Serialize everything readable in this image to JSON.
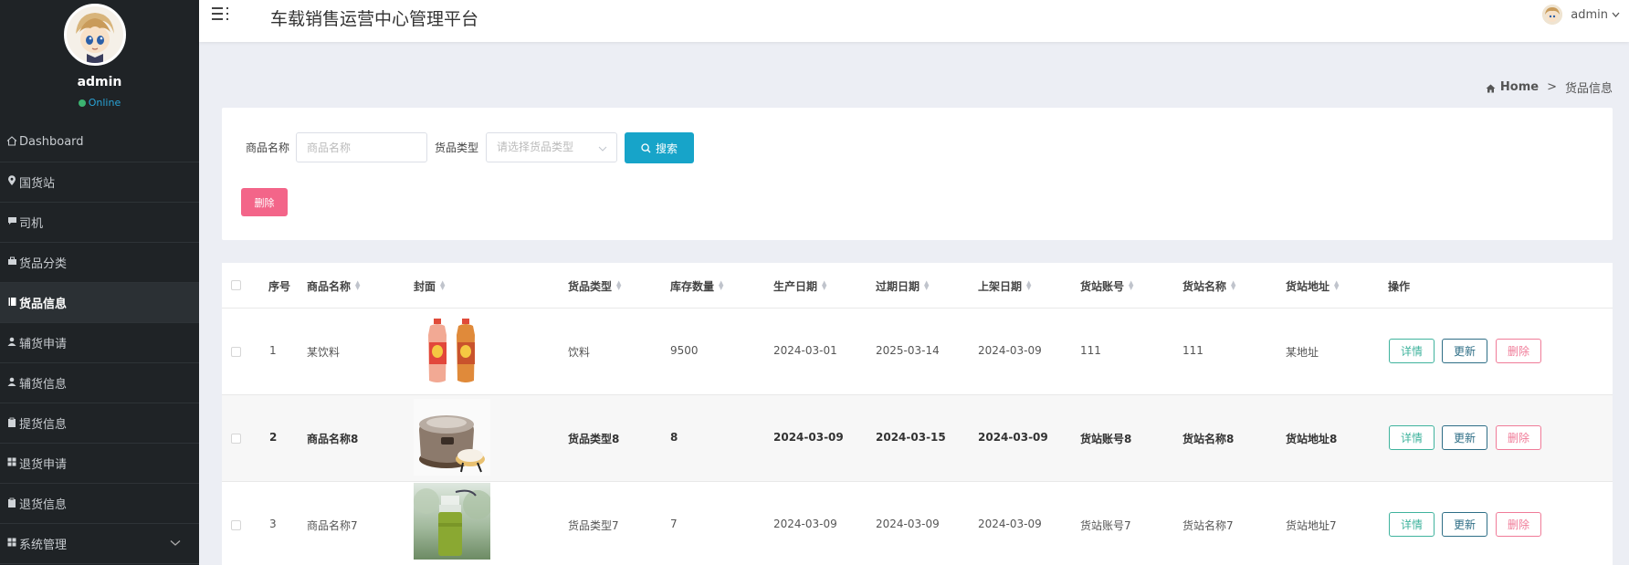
{
  "sidebar": {
    "user": {
      "name": "admin",
      "status": "Online"
    },
    "items": [
      {
        "label": "Dashboard",
        "icon": "home-icon"
      },
      {
        "label": "国货站",
        "icon": "map-pin-icon"
      },
      {
        "label": "司机",
        "icon": "comment-icon"
      },
      {
        "label": "货品分类",
        "icon": "briefcase-icon"
      },
      {
        "label": "货品信息",
        "icon": "book-icon",
        "active": true
      },
      {
        "label": "辅货申请",
        "icon": "user-icon"
      },
      {
        "label": "辅货信息",
        "icon": "user-icon"
      },
      {
        "label": "提货信息",
        "icon": "clipboard-icon"
      },
      {
        "label": "退货申请",
        "icon": "grid-icon"
      },
      {
        "label": "退货信息",
        "icon": "clipboard-icon"
      },
      {
        "label": "系统管理",
        "icon": "grid-icon",
        "expandable": true
      }
    ]
  },
  "header": {
    "title": "车载销售运营中心管理平台",
    "user": "admin"
  },
  "breadcrumb": {
    "home": "Home",
    "sep": ">",
    "current": "货品信息"
  },
  "search": {
    "name_label": "商品名称",
    "name_placeholder": "商品名称",
    "type_label": "货品类型",
    "type_placeholder": "请选择货品类型",
    "search_button": "搜索",
    "delete_button": "删除"
  },
  "table": {
    "columns": [
      "序号",
      "商品名称",
      "封面",
      "货品类型",
      "库存数量",
      "生产日期",
      "过期日期",
      "上架日期",
      "货站账号",
      "货站名称",
      "货站地址",
      "操作"
    ],
    "actions": {
      "detail": "详情",
      "update": "更新",
      "delete": "删除"
    },
    "rows": [
      {
        "index": "1",
        "name": "某饮料",
        "type": "饮料",
        "stock": "9500",
        "produced": "2024-03-01",
        "expires": "2025-03-14",
        "listed": "2024-03-09",
        "account": "111",
        "station": "111",
        "address": "某地址",
        "cover": "tea-bottles"
      },
      {
        "index": "2",
        "name": "商品名称8",
        "type": "货品类型8",
        "stock": "8",
        "produced": "2024-03-09",
        "expires": "2024-03-15",
        "listed": "2024-03-09",
        "account": "货站账号8",
        "station": "货站名称8",
        "address": "货站地址8",
        "cover": "rice-cooker"
      },
      {
        "index": "3",
        "name": "商品名称7",
        "type": "货品类型7",
        "stock": "7",
        "produced": "2024-03-09",
        "expires": "2024-03-09",
        "listed": "2024-03-09",
        "account": "货站账号7",
        "station": "货站名称7",
        "address": "货站地址7",
        "cover": "green-bottle"
      }
    ]
  },
  "colors": {
    "sidebar_bg": "#1f2326",
    "search_btn": "#17a4c9",
    "delete_btn": "#f36589",
    "online": "#3cb371"
  }
}
